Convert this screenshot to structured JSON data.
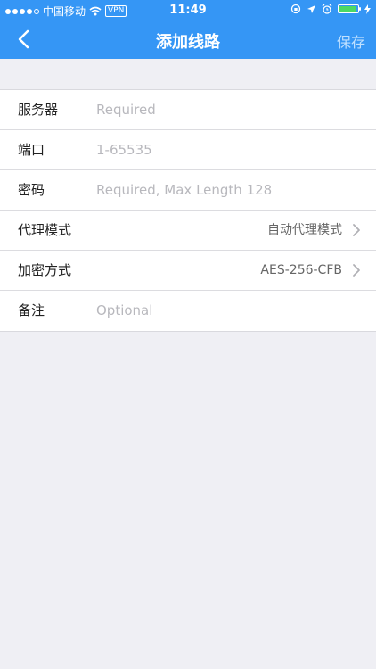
{
  "status_bar": {
    "carrier": "中国移动",
    "vpn": "VPN",
    "time": "11:49"
  },
  "nav": {
    "title": "添加线路",
    "save_label": "保存"
  },
  "form": {
    "rows": [
      {
        "label": "服务器",
        "placeholder": "Required"
      },
      {
        "label": "端口",
        "placeholder": "1-65535"
      },
      {
        "label": "密码",
        "placeholder": "Required, Max Length 128"
      },
      {
        "label": "代理模式",
        "value": "自动代理模式"
      },
      {
        "label": "加密方式",
        "value": "AES-256-CFB"
      },
      {
        "label": "备注",
        "placeholder": "Optional"
      }
    ]
  },
  "colors": {
    "accent": "#3596f5",
    "background": "#efeff4"
  }
}
